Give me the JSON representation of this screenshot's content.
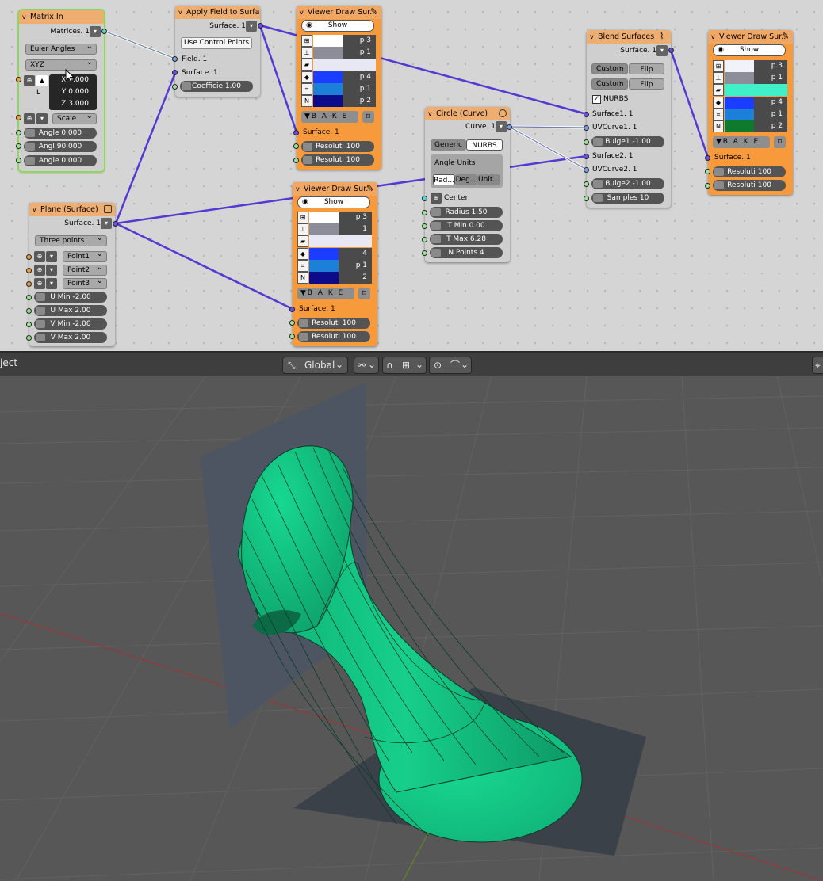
{
  "matrix_in": {
    "title": "Matrix In",
    "matrices_out": "Matrices. 1",
    "rotation_mode": "Euler Angles",
    "euler_order": "XYZ",
    "loc_label": "L",
    "x": "X  0.000",
    "y": "Y  0.000",
    "z": "Z  3.000",
    "scale_label": "Scale",
    "angle1": "Angle  0.000",
    "angle2": "Angl  90.000",
    "angle3": "Angle  0.000"
  },
  "apply_field": {
    "title": "Apply Field to Surface",
    "surface_out": "Surface. 1",
    "use_control_points": "Use Control Points",
    "field_in": "Field. 1",
    "surface_in": "Surface. 1",
    "coefficient": "Coefficie  1.00"
  },
  "viewer1": {
    "title": "Viewer Draw Sur...",
    "show_label": "Show",
    "rows": [
      "p 3",
      "p 1",
      "",
      "p 4",
      "p 1",
      "p 2"
    ],
    "colors": [
      "#ffffff",
      "#8d8d9a",
      "#e8e8f4",
      "#1a3dff",
      "#1c7fd8",
      "#0c0c8a"
    ],
    "bake_label": "B A K E",
    "surface_in": "Surface. 1",
    "res1": "Resoluti  100",
    "res2": "Resoluti  100"
  },
  "viewer2": {
    "title": "Viewer Draw Sur...",
    "show_label": "Show",
    "rows": [
      "p 3",
      "1",
      "",
      "4",
      "p 1",
      "2"
    ],
    "colors": [
      "#ffffff",
      "#8d8d9a",
      "#e8e8f4",
      "#1a3dff",
      "#1c7fd8",
      "#0c0c8a"
    ],
    "bake_label": "B A K E",
    "surface_in": "Surface. 1",
    "res1": "Resoluti  100",
    "res2": "Resoluti  100"
  },
  "viewer3": {
    "title": "Viewer Draw Sur...",
    "show_label": "Show",
    "rows": [
      "p 3",
      "p 1",
      "",
      "p 4",
      "p 1",
      "p 2"
    ],
    "colors": [
      "#f2f2fa",
      "#8d8d9a",
      "#3ff0c8",
      "#1a3dff",
      "#1c7fd8",
      "#0d7a2d"
    ],
    "bake_label": "B A K E",
    "surface_in": "Surface. 1",
    "res1": "Resoluti  100",
    "res2": "Resoluti  100"
  },
  "plane": {
    "title": "Plane (Surface)",
    "surface_out": "Surface. 1",
    "mode": "Three points",
    "point1": "Point1",
    "point2": "Point2",
    "point3": "Point3",
    "umin": "U Min   -2.00",
    "umax": "U Max   2.00",
    "vmin": "V Min   -2.00",
    "vmax": "V Max   2.00"
  },
  "circle": {
    "title": "Circle (Curve)",
    "curve_out": "Curve. 1",
    "mode_generic": "Generic",
    "mode_nurbs": "NURBS",
    "angle_units": "Angle Units",
    "units": [
      "Rad...",
      "Deg...",
      "Unit..."
    ],
    "center": "Center",
    "radius": "Radius  1.50",
    "tmin": "T Min  0.00",
    "tmax": "T Max  6.28",
    "npoints": "N Points  4"
  },
  "blend": {
    "title": "Blend Surfaces",
    "surface_out": "Surface. 1",
    "custom1": "Custom",
    "flip1": "Flip",
    "custom2": "Custom",
    "flip2": "Flip",
    "nurbs_label": "NURBS",
    "surface1": "Surface1. 1",
    "uvcurve1": "UVCurve1. 1",
    "bulge1": "Bulge1  -1.00",
    "surface2": "Surface2. 1",
    "uvcurve2": "UVCurve2. 1",
    "bulge2": "Bulge2  -1.00",
    "samples": "Samples  10"
  },
  "header": {
    "mode_text": "ject",
    "orientation": "Global"
  },
  "colors": {
    "surface_green": "#10c282",
    "plane_grey": "#4c5561",
    "link_purple": "#5638d2",
    "node_orange": "#f79a3b"
  }
}
